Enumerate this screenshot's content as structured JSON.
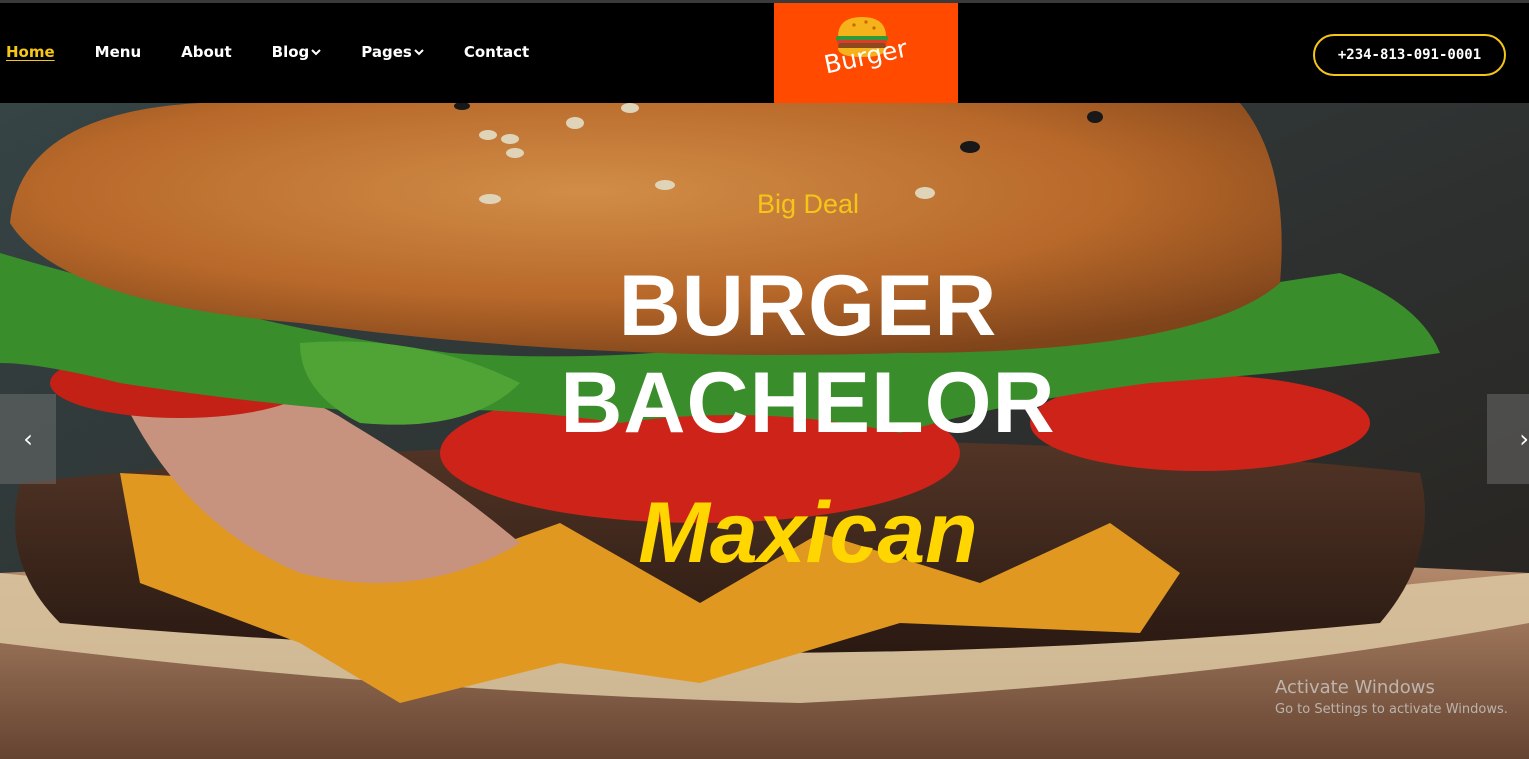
{
  "nav": {
    "items": [
      {
        "label": "Home",
        "active": true,
        "dropdown": false
      },
      {
        "label": "Menu",
        "active": false,
        "dropdown": false
      },
      {
        "label": "About",
        "active": false,
        "dropdown": false
      },
      {
        "label": "Blog",
        "active": false,
        "dropdown": true
      },
      {
        "label": "Pages",
        "active": false,
        "dropdown": true
      },
      {
        "label": "Contact",
        "active": false,
        "dropdown": false
      }
    ]
  },
  "logo": {
    "text": "Burger",
    "icon": "burger-icon",
    "bg_color": "#ff4a00"
  },
  "phone": {
    "label": "+234-813-091-0001",
    "border_color": "#f5c518"
  },
  "hero": {
    "eyebrow": "Big Deal",
    "title_line1": "BURGER",
    "title_line2": "BACHELOR",
    "subtitle": "Maxican",
    "prev_icon": "chevron-left-icon",
    "next_icon": "chevron-right-icon",
    "prev_glyph": "‹",
    "next_glyph": "›"
  },
  "watermark": {
    "line1": "Activate Windows",
    "line2": "Go to Settings to activate Windows."
  },
  "colors": {
    "accent": "#f5c518",
    "subtitle": "#ffd600",
    "navbar": "#000000"
  }
}
